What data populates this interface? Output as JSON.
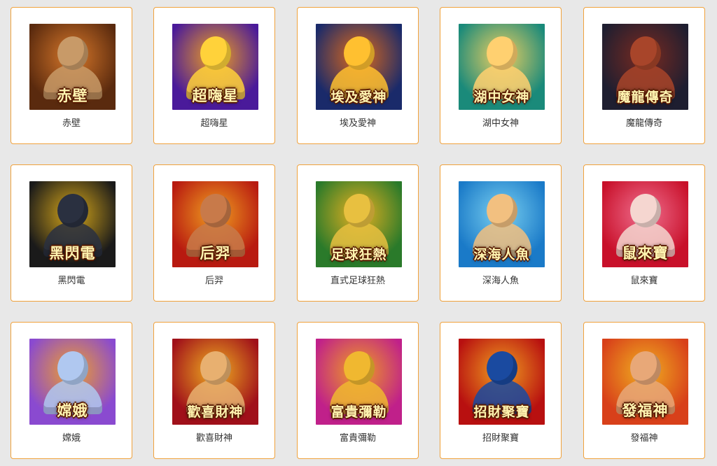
{
  "games": [
    {
      "name": "赤壁",
      "logo": "赤壁",
      "bg": "#5a2a0e",
      "bg2": "#d8782a",
      "fig": "#c89a68"
    },
    {
      "name": "超嗨星",
      "logo": "超嗨星",
      "bg": "#4a1a9a",
      "bg2": "#f0a020",
      "fig": "#ffd23a"
    },
    {
      "name": "埃及愛神",
      "logo": "埃及愛神",
      "bg": "#1a2a6a",
      "bg2": "#e06a1a",
      "fig": "#ffc030"
    },
    {
      "name": "湖中女神",
      "logo": "湖中女神",
      "bg": "#1a8a7a",
      "bg2": "#f0d060",
      "fig": "#ffd070"
    },
    {
      "name": "魔龍傳奇",
      "logo": "魔龍傳奇",
      "bg": "#1e1e30",
      "bg2": "#7a2a20",
      "fig": "#a8452a"
    },
    {
      "name": "黑閃電",
      "logo": "黑閃電",
      "bg": "#1a1a1a",
      "bg2": "#d8a81a",
      "fig": "#2a3040"
    },
    {
      "name": "后羿",
      "logo": "后羿",
      "bg": "#b81a10",
      "bg2": "#f0a020",
      "fig": "#c87a4a"
    },
    {
      "name": "直式足球狂熱",
      "logo": "足球狂熱",
      "bg": "#2a7a2a",
      "bg2": "#e8b020",
      "fig": "#e8c040"
    },
    {
      "name": "深海人魚",
      "logo": "深海人魚",
      "bg": "#1a7ac8",
      "bg2": "#7ad0f0",
      "fig": "#f2c080"
    },
    {
      "name": "鼠來寶",
      "logo": "鼠來寶",
      "bg": "#c8102a",
      "bg2": "#f07090",
      "fig": "#f5d6d0"
    },
    {
      "name": "嫦娥",
      "logo": "嫦娥",
      "bg": "#8a4ad0",
      "bg2": "#f0a02a",
      "fig": "#b0c8f0"
    },
    {
      "name": "歡喜財神",
      "logo": "歡喜財神",
      "bg": "#a0101a",
      "bg2": "#f0b020",
      "fig": "#e8b070"
    },
    {
      "name": "富貴彌勒",
      "logo": "富貴彌勒",
      "bg": "#c0208a",
      "bg2": "#f0a020",
      "fig": "#f0b830"
    },
    {
      "name": "招財聚寶",
      "logo": "招財聚寶",
      "bg": "#b81010",
      "bg2": "#f0a020",
      "fig": "#1a4aa0"
    },
    {
      "name": "發福神",
      "logo": "發福神",
      "bg": "#d8401a",
      "bg2": "#f0b020",
      "fig": "#e8a878"
    }
  ]
}
